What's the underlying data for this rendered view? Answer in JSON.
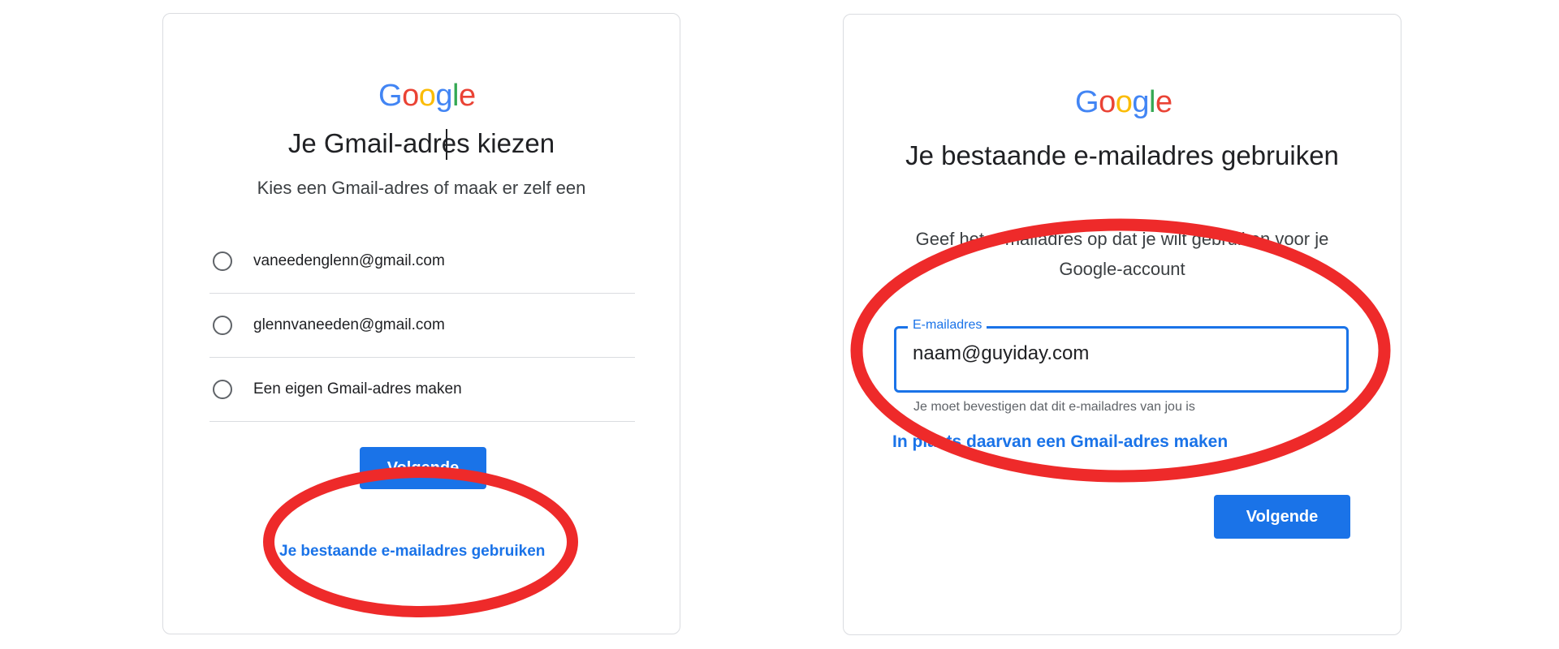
{
  "left_panel": {
    "logo_letters": [
      {
        "ch": "G",
        "color": "#4285f4"
      },
      {
        "ch": "o",
        "color": "#ea4335"
      },
      {
        "ch": "o",
        "color": "#fbbc05"
      },
      {
        "ch": "g",
        "color": "#4285f4"
      },
      {
        "ch": "l",
        "color": "#34a853"
      },
      {
        "ch": "e",
        "color": "#ea4335"
      }
    ],
    "title": "Je Gmail-adres kiezen",
    "subtitle": "Kies een Gmail-adres of maak er zelf een",
    "options": [
      {
        "label": "vaneedenglenn@gmail.com",
        "selected": false
      },
      {
        "label": "glennvaneeden@gmail.com",
        "selected": false
      },
      {
        "label": "Een eigen Gmail-adres maken",
        "selected": false
      }
    ],
    "next_label": "Volgende",
    "existing_email_link": "Je bestaande e-mailadres gebruiken"
  },
  "right_panel": {
    "title": "Je bestaande e-mailadres gebruiken",
    "subtitle": "Geef het e-mailadres op dat je wilt gebruiken voor je Google-account",
    "email_field": {
      "label": "E-mailadres",
      "value": "naam@guyiday.com"
    },
    "helper_text": "Je moet bevestigen dat dit e-mailadres van jou is",
    "gmail_link": "In plaats daarvan een Gmail-adres maken",
    "next_label": "Volgende"
  },
  "colors": {
    "accent_blue": "#1a73e8",
    "annotation_red": "#ee2a2a",
    "border_gray": "#dadce0"
  }
}
